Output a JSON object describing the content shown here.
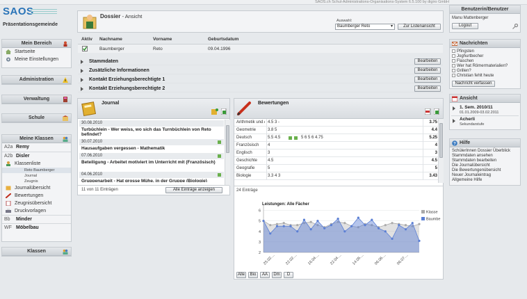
{
  "app": {
    "window_title": "SAOS.ch Schul-Administrations-Organisations-System 6.5.100 by digiro GmbH",
    "logo": "SAOS",
    "school": "Präsentationsgemeinde"
  },
  "left_nav": {
    "mein_bereich": {
      "title": "Mein Bereich",
      "items": [
        "Startseite",
        "Meine Einstellungen"
      ]
    },
    "administration": "Administration",
    "verwaltung": "Verwaltung",
    "schule": "Schule",
    "meine_klassen": {
      "title": "Meine Klassen",
      "classes": [
        {
          "code": "A2a",
          "name": "Remy"
        },
        {
          "code": "A2b",
          "name": "Disler"
        }
      ],
      "klassenliste": "Klassenliste",
      "student": "Reto Baumberger",
      "student_sub": [
        "Journal",
        "Zeugnis"
      ],
      "tools": [
        "Journalübersicht",
        "Bewertungen",
        "Zeugnisübersicht",
        "Druckvorlagen"
      ],
      "other_classes": [
        {
          "code": "Bb",
          "name": "Minder"
        },
        {
          "code": "WF",
          "name": "Möbelbau"
        }
      ]
    },
    "klassen": "Klassen"
  },
  "dossier": {
    "title": "Dossier",
    "subtitle": "- Ansicht",
    "select_label": "Auswahl:",
    "select_value": "Baumberger Reto",
    "list_button": "Zur Listenansicht",
    "columns": [
      "Aktiv",
      "Nachname",
      "Vorname",
      "Geburtsdatum"
    ],
    "student": {
      "nachname": "Baumberger",
      "vorname": "Reto",
      "geburtsdatum": "09.04.1996"
    },
    "sections": [
      "Stammdaten",
      "Zusätzliche Informationen",
      "Kontakt Erziehungsberechtigte 1",
      "Kontakt Erziehungsberechtigte 2"
    ],
    "edit_label": "Bearbeiten"
  },
  "journal": {
    "title": "Journal",
    "entries": [
      {
        "date": "30.08.2010",
        "text": "Turbüchlein - Wer weiss, wo sich das Turnbüchlein von Reto befindet?"
      },
      {
        "date": "30.07.2010",
        "text": "Hausaufgaben vergessen - Mathematik"
      },
      {
        "date": "07.06.2010",
        "text": "Beteiligung - Arbeitet motiviert im Unterricht mit (Französisch)"
      },
      {
        "date": "04.06.2010",
        "text": "Gruppenarbeit - Hat grosse Mühe, in der Gruppe (Biologie)"
      }
    ],
    "count": "11 von 11 Einträgen",
    "all_button": "Alle Einträge anzeigen"
  },
  "bewertungen": {
    "title": "Bewertungen",
    "rows": [
      {
        "subject": "Arithmetik und Algebra",
        "grades": "4.5   3   -",
        "avg": "3.75"
      },
      {
        "subject": "Geometrie",
        "grades": "3.8   5",
        "avg": "4.4"
      },
      {
        "subject": "Deutsch",
        "grades": "5.5   4.5",
        "grades2": "5   6   5   6   4.75",
        "avg": "5.25"
      },
      {
        "subject": "Französisch",
        "grades": "4",
        "avg": "4"
      },
      {
        "subject": "Englisch",
        "grades": "3",
        "avg": "3"
      },
      {
        "subject": "Geschichte",
        "grades": "4.5",
        "avg": "4.5"
      },
      {
        "subject": "Geografie",
        "grades": "5",
        "avg": "5"
      },
      {
        "subject": "Biologie",
        "grades": "3.3   4   3",
        "avg": "3.43"
      }
    ],
    "count": "24 Einträge",
    "filter_buttons": [
      "Alle",
      "Bio",
      "AA",
      "Dm",
      "D"
    ]
  },
  "chart_data": {
    "type": "area",
    "title": "Leistungen: Alle Fächer",
    "ylim": [
      2,
      6.5
    ],
    "yticks": [
      2,
      3,
      4,
      5,
      6
    ],
    "xticks": [
      "25.02....",
      "22.02....",
      "16.04....",
      "22.04....",
      "14.05....",
      "06.06....",
      "06.07...."
    ],
    "series": [
      {
        "name": "Klasse",
        "color": "#aaaaaa",
        "values": [
          5.0,
          4.6,
          4.7,
          4.8,
          4.6,
          4.6,
          4.8,
          4.9,
          4.6,
          4.4,
          4.7,
          4.9,
          4.8,
          4.5,
          4.4,
          4.7,
          4.6,
          4.4,
          4.6,
          4.8,
          4.7,
          4.6,
          4.5,
          4.7
        ]
      },
      {
        "name": "Baumberger",
        "color": "#5b7fd4",
        "values": [
          5.0,
          3.8,
          4.5,
          4.5,
          4.5,
          4.0,
          5.1,
          4.2,
          5.0,
          4.3,
          4.6,
          5.2,
          4.0,
          4.5,
          5.3,
          4.6,
          5.1,
          4.3,
          4.0,
          3.3,
          4.6,
          4.2,
          4.8,
          3.1
        ]
      }
    ]
  },
  "right_nav": {
    "user": {
      "title": "Benutzerin/Benutzer",
      "name": "Manu Mattenberger",
      "logout": "Logout"
    },
    "nachrichten": {
      "title": "Nachrichten",
      "items": [
        "Pfingsten",
        "Joghurtbecher",
        "Flaschen",
        "Wer hat Römermaterialien?",
        "Grillen?",
        "Christian fehlt heute"
      ],
      "button": "Nachricht verfassen"
    },
    "ansicht": {
      "title": "Ansicht",
      "semester": "1. Sem. 2010/11",
      "dates": "01.01.2009-03.02.2011",
      "school": "Acherli",
      "level": "Sekundarstufe"
    },
    "hilfe": {
      "title": "Hilfe",
      "items": [
        "SchülerInnen Dossier Überblick",
        "Stammdaten ansehen",
        "Stammdaten bearbeiten",
        "Die Journalübersicht",
        "Die Bewertungenübersicht",
        "Neuer Journaleintrag",
        "Allgemeine Hilfe"
      ]
    }
  }
}
